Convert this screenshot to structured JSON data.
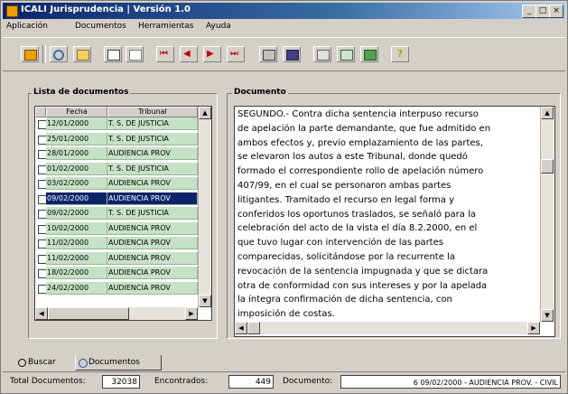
{
  "window": {
    "title": "ICALI Jurisprudencia | Versión 1.0",
    "minimize_glyph": "_",
    "maximize_glyph": "□",
    "close_glyph": "×"
  },
  "menu": {
    "items": [
      "Aplicación",
      "Documentos",
      "Herramientas",
      "Ayuda"
    ]
  },
  "toolbar": {
    "buttons": [
      "exit-icon",
      "search-icon",
      "folder-icon",
      "view-icon",
      "page-icon",
      "first-icon",
      "prev-icon",
      "next-icon",
      "last-icon",
      "print-icon",
      "save-icon",
      "options-icon",
      "settings-icon",
      "export-icon",
      "help-icon"
    ],
    "help_glyph": "?"
  },
  "list": {
    "title": "Lista de documentos",
    "headers": {
      "fecha": "Fecha",
      "tribunal": "Tribunal"
    },
    "rows": [
      {
        "fecha": "12/01/2000",
        "tribunal": "T. S. DE JUSTICIA"
      },
      {
        "fecha": "25/01/2000",
        "tribunal": "T. S. DE JUSTICIA"
      },
      {
        "fecha": "28/01/2000",
        "tribunal": "AUDIENCIA PROV"
      },
      {
        "fecha": "01/02/2000",
        "tribunal": "T. S. DE JUSTICIA"
      },
      {
        "fecha": "03/02/2000",
        "tribunal": "AUDIENCIA PROV"
      },
      {
        "fecha": "09/02/2000",
        "tribunal": "AUDIENCIA PROV",
        "selected": true
      },
      {
        "fecha": "09/02/2000",
        "tribunal": "T. S. DE JUSTICIA"
      },
      {
        "fecha": "10/02/2000",
        "tribunal": "AUDIENCIA PROV"
      },
      {
        "fecha": "11/02/2000",
        "tribunal": "AUDIENCIA PROV"
      },
      {
        "fecha": "11/02/2000",
        "tribunal": "AUDIENCIA PROV"
      },
      {
        "fecha": "18/02/2000",
        "tribunal": "AUDIENCIA PROV"
      },
      {
        "fecha": "24/02/2000",
        "tribunal": "AUDIENCIA PROV"
      }
    ]
  },
  "document": {
    "title": "Documento",
    "lines": [
      "SEGUNDO.- Contra dicha sentencia interpuso recurso",
      "de apelación la parte demandante, que fue admitido en",
      "ambos efectos y, previo emplazamiento de las partes,",
      "se elevaron los autos a este Tribunal, donde quedó",
      "formado el correspondiente rollo de apelación número",
      "407/99, en el cual se personaron ambas partes",
      "litigantes. Tramitado el recurso en legal forma y",
      "conferidos los oportunos traslados, se señaló para la",
      "celebración del acto de la vista el día 8.2.2000, en el",
      "que tuvo lugar con intervención de las partes",
      "comparecidas, solicitándose por la recurrente la",
      "revocación de la sentencia impugnada y que se dictara",
      "otra de conformidad con sus intereses y por la apelada",
      "la íntegra confirmación de dicha sentencia, con",
      "imposición de costas."
    ]
  },
  "tabs": {
    "buscar": "Buscar",
    "documentos": "Documentos"
  },
  "status": {
    "total_label": "Total Documentos:",
    "total_value": "32038",
    "found_label": "Encontrados:",
    "found_value": "449",
    "doc_label": "Documento:",
    "doc_value": "6 09/02/2000 - AUDIENCIA PROV. - CIVIL"
  },
  "colors": {
    "row_green": "#c6e2c6",
    "selection": "#0a246a",
    "title_gradient_start": "#0a246a"
  }
}
